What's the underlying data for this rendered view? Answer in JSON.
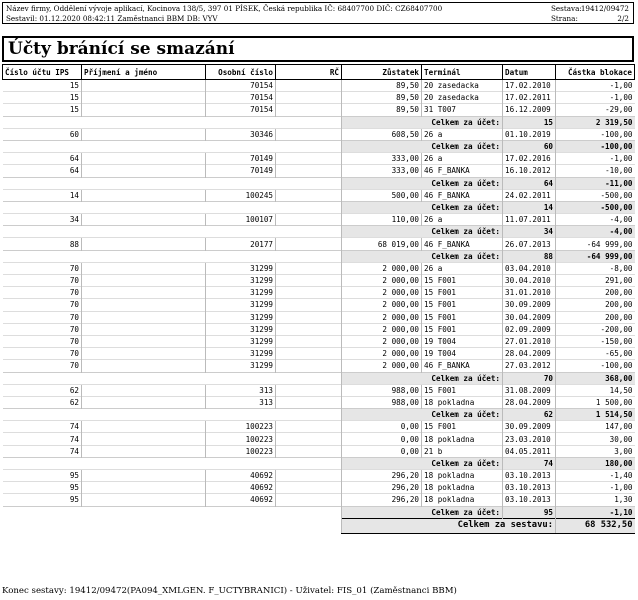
{
  "header": {
    "line1": "Název firmy, Oddělení vývoje aplikací, Kocinova 138/5, 397 01 PÍSEK, Česká republika  IČ: 68407700  DIČ: CZ68407700",
    "line2": "Sestavil: 01.12.2020 08:42:11 Zaměstnanci BBM  DB: VYV",
    "sestava_label": "Sestava:",
    "sestava_value": "19412/09472",
    "strana_label": "Strana:",
    "strana_value": "2/2"
  },
  "title": "Účty bránící se smazání",
  "columns": [
    "Číslo účtu IPS",
    "Příjmení a jméno",
    "Osobní číslo",
    "RČ",
    "Zůstatek",
    "Terminál",
    "Datum",
    "Částka blokace"
  ],
  "groups": [
    {
      "rows": [
        [
          "15",
          "",
          "70154",
          "",
          "89,50",
          "20 zasedacka",
          "17.02.2010",
          "-1,00"
        ],
        [
          "15",
          "",
          "70154",
          "",
          "89,50",
          "20 zasedacka",
          "17.02.2011",
          "-1,00"
        ],
        [
          "15",
          "",
          "70154",
          "",
          "89,50",
          "31 T007",
          "16.12.2009",
          "-29,00"
        ]
      ],
      "subtotal": {
        "label": "Celkem za účet:",
        "account": "15",
        "amount": "2 319,50"
      }
    },
    {
      "rows": [
        [
          "60",
          "",
          "30346",
          "",
          "608,50",
          "26 a",
          "01.10.2019",
          "-100,00"
        ]
      ],
      "subtotal": {
        "label": "Celkem za účet:",
        "account": "60",
        "amount": "-100,00"
      }
    },
    {
      "rows": [
        [
          "64",
          "",
          "70149",
          "",
          "333,00",
          "26 a",
          "17.02.2016",
          "-1,00"
        ],
        [
          "64",
          "",
          "70149",
          "",
          "333,00",
          "46 F_BANKA",
          "16.10.2012",
          "-10,00"
        ]
      ],
      "subtotal": {
        "label": "Celkem za účet:",
        "account": "64",
        "amount": "-11,00"
      }
    },
    {
      "rows": [
        [
          "14",
          "",
          "100245",
          "",
          "500,00",
          "46 F_BANKA",
          "24.02.2011",
          "-500,00"
        ]
      ],
      "subtotal": {
        "label": "Celkem za účet:",
        "account": "14",
        "amount": "-500,00"
      }
    },
    {
      "rows": [
        [
          "34",
          "",
          "100107",
          "",
          "110,00",
          "26 a",
          "11.07.2011",
          "-4,00"
        ]
      ],
      "subtotal": {
        "label": "Celkem za účet:",
        "account": "34",
        "amount": "-4,00"
      }
    },
    {
      "rows": [
        [
          "88",
          "",
          "20177",
          "",
          "68 019,00",
          "46 F_BANKA",
          "26.07.2013",
          "-64 999,00"
        ]
      ],
      "subtotal": {
        "label": "Celkem za účet:",
        "account": "88",
        "amount": "-64 999,00"
      }
    },
    {
      "rows": [
        [
          "70",
          "",
          "31299",
          "",
          "2 000,00",
          "26 a",
          "03.04.2010",
          "-8,00"
        ],
        [
          "70",
          "",
          "31299",
          "",
          "2 000,00",
          "15 F001",
          "30.04.2010",
          "291,00"
        ],
        [
          "70",
          "",
          "31299",
          "",
          "2 000,00",
          "15 F001",
          "31.01.2010",
          "200,00"
        ],
        [
          "70",
          "",
          "31299",
          "",
          "2 000,00",
          "15 F001",
          "30.09.2009",
          "200,00"
        ],
        [
          "70",
          "",
          "31299",
          "",
          "2 000,00",
          "15 F001",
          "30.04.2009",
          "200,00"
        ],
        [
          "70",
          "",
          "31299",
          "",
          "2 000,00",
          "15 F001",
          "02.09.2009",
          "-200,00"
        ],
        [
          "70",
          "",
          "31299",
          "",
          "2 000,00",
          "19 T004",
          "27.01.2010",
          "-150,00"
        ],
        [
          "70",
          "",
          "31299",
          "",
          "2 000,00",
          "19 T004",
          "28.04.2009",
          "-65,00"
        ],
        [
          "70",
          "",
          "31299",
          "",
          "2 000,00",
          "46 F_BANKA",
          "27.03.2012",
          "-100,00"
        ]
      ],
      "subtotal": {
        "label": "Celkem za účet:",
        "account": "70",
        "amount": "368,00"
      }
    },
    {
      "rows": [
        [
          "62",
          "",
          "313",
          "",
          "988,00",
          "15 F001",
          "31.08.2009",
          "14,50"
        ],
        [
          "62",
          "",
          "313",
          "",
          "988,00",
          "18 pokladna",
          "28.04.2009",
          "1 500,00"
        ]
      ],
      "subtotal": {
        "label": "Celkem za účet:",
        "account": "62",
        "amount": "1 514,50"
      }
    },
    {
      "rows": [
        [
          "74",
          "",
          "100223",
          "",
          "0,00",
          "15 F001",
          "30.09.2009",
          "147,00"
        ],
        [
          "74",
          "",
          "100223",
          "",
          "0,00",
          "18 pokladna",
          "23.03.2010",
          "30,00"
        ],
        [
          "74",
          "",
          "100223",
          "",
          "0,00",
          "21 b",
          "04.05.2011",
          "3,00"
        ]
      ],
      "subtotal": {
        "label": "Celkem za účet:",
        "account": "74",
        "amount": "180,00"
      }
    },
    {
      "rows": [
        [
          "95",
          "",
          "40692",
          "",
          "296,20",
          "18 pokladna",
          "03.10.2013",
          "-1,40"
        ],
        [
          "95",
          "",
          "40692",
          "",
          "296,20",
          "18 pokladna",
          "03.10.2013",
          "-1,00"
        ],
        [
          "95",
          "",
          "40692",
          "",
          "296,20",
          "18 pokladna",
          "03.10.2013",
          "1,30"
        ]
      ],
      "subtotal": {
        "label": "Celkem za účet:",
        "account": "95",
        "amount": "-1,10"
      }
    }
  ],
  "grand_total": {
    "label": "Celkem za sestavu:",
    "amount": "68 532,50"
  },
  "footer": "Konec sestavy: 19412/09472(PA094_XMLGEN. F_UCTYBRANICI) - Uživatel: FIS_01 (Zaměstnanci BBM)"
}
